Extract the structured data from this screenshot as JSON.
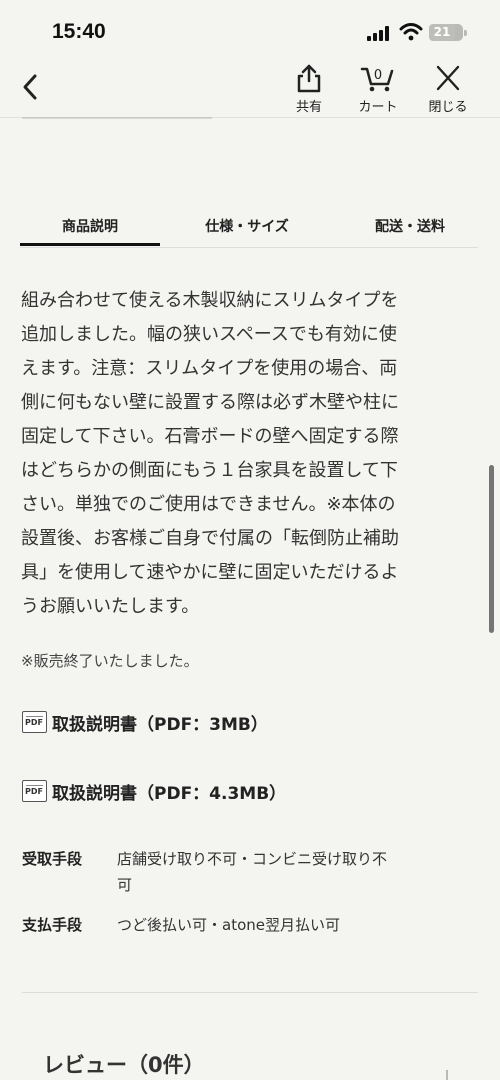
{
  "status": {
    "time": "15:40",
    "battery": "21"
  },
  "nav": {
    "back_icon": "chevron-left-icon",
    "share_label": "共有",
    "cart_label": "カート",
    "cart_count": "0",
    "close_label": "閉じる"
  },
  "tabs": [
    {
      "label": "商品説明"
    },
    {
      "label": "仕様・サイズ"
    },
    {
      "label": "配送・送料"
    }
  ],
  "description": {
    "lines": [
      "組み合わせて使える木製収納にスリムタイプを",
      "追加しました。幅の狭いスペースでも有効に使",
      "えます。注意：スリムタイプを使用の場合、両",
      "側に何もない壁に設置する際は必ず木壁や柱に",
      "固定して下さい。石膏ボードの壁へ固定する際",
      "はどちらかの側面にもう１台家具を設置して下",
      "さい。単独でのご使用はできません。※本体の",
      "設置後、お客様ご自身で付属の「転倒防止補助",
      "具」を使用して速やかに壁に固定いただけるよ",
      "うお願いいたします。"
    ],
    "sold_out": "※販売終了いたしました。"
  },
  "manuals": [
    {
      "icon": "PDF",
      "label": "取扱説明書（PDF：3MB）"
    },
    {
      "icon": "PDF",
      "label": "取扱説明書（PDF：4.3MB）"
    }
  ],
  "info": {
    "receive_label": "受取手段",
    "receive_value": "店舗受け取り不可・コンビニ受け取り不可",
    "receive_value_line1": "店舗受け取り不可・コンビニ受け取り不",
    "receive_value_line2": "可",
    "payment_label": "支払手段",
    "payment_value": "つど後払い可・atone翌月払い可"
  },
  "review": {
    "title": "レビュー（0件）"
  }
}
